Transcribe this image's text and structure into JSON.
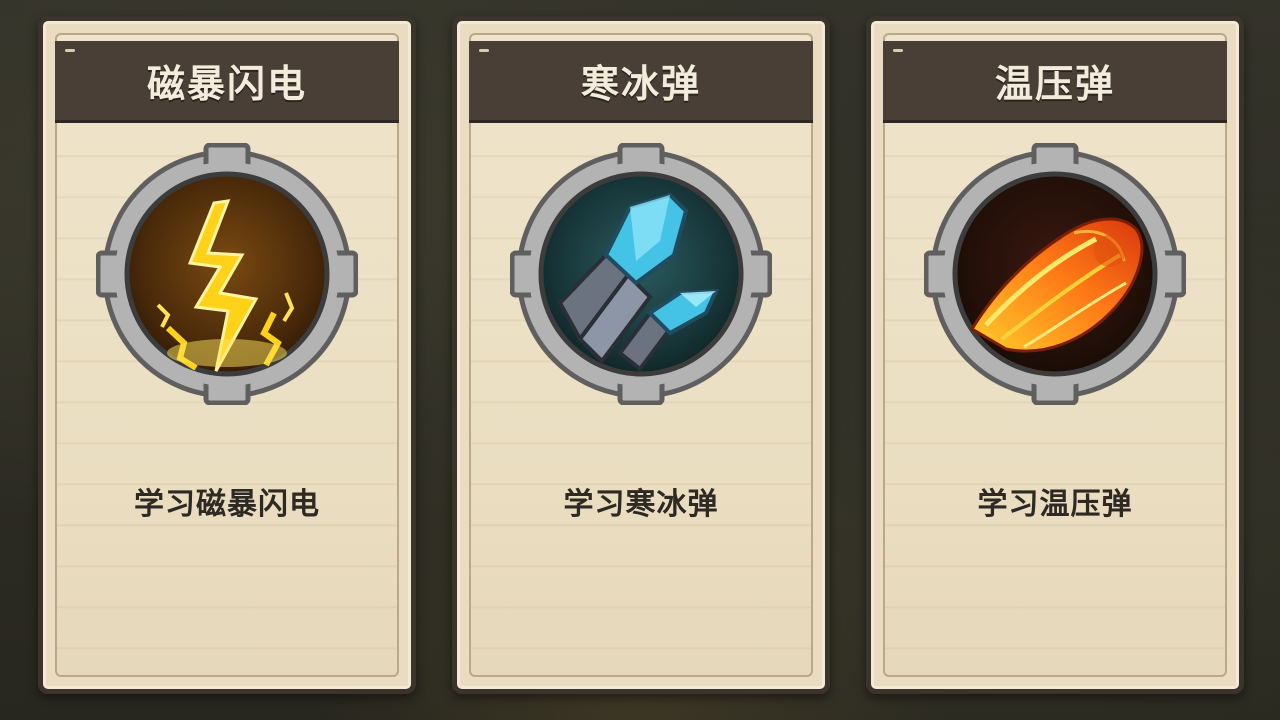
{
  "cards": [
    {
      "title": "磁暴闪电",
      "action_label": "学习磁暴闪电",
      "icon": "lightning-icon",
      "accent_color": "#f5c516"
    },
    {
      "title": "寒冰弹",
      "action_label": "学习寒冰弹",
      "icon": "ice-shard-icon",
      "accent_color": "#49c4e6"
    },
    {
      "title": "温压弹",
      "action_label": "学习温压弹",
      "icon": "fire-comet-icon",
      "accent_color": "#f06a12"
    }
  ]
}
